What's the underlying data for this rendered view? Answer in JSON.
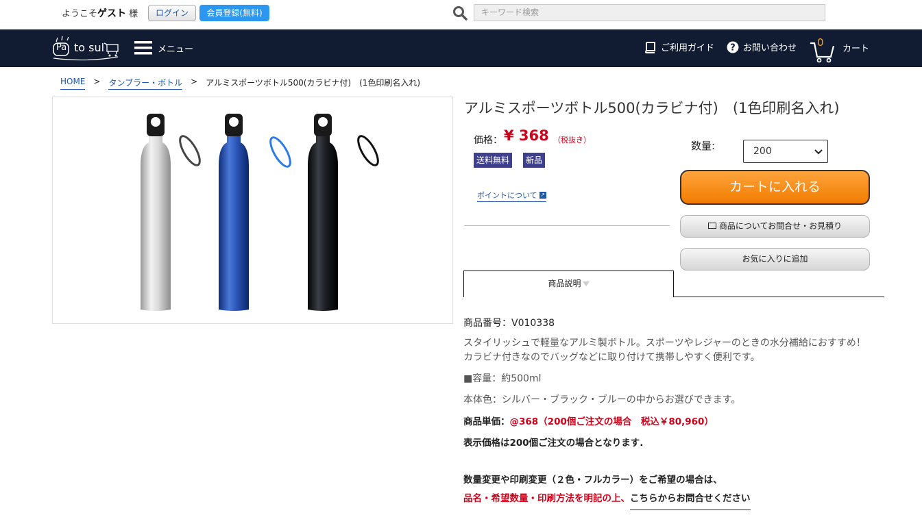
{
  "header": {
    "welcome_prefix": "ようこそ",
    "welcome_user": "ゲスト",
    "welcome_suffix": " 様",
    "login_label": "ログイン",
    "register_label": "会員登録(無料)",
    "search_placeholder": "キーワード検索"
  },
  "nav": {
    "logo_text": "to sul",
    "logo_badge": "Pa",
    "menu_label": "メニュー",
    "guide_label": "ご利用ガイド",
    "contact_label": "お問い合わせ",
    "cart_count": "0",
    "cart_label": "カート"
  },
  "breadcrumb": {
    "home": "HOME",
    "sep": ">",
    "category": "タンブラー・ボトル",
    "current": "アルミスポーツボトル500(カラビナ付)　(1色印刷名入れ)"
  },
  "product": {
    "title": "アルミスポーツボトル500(カラビナ付)　(1色印刷名入れ)",
    "price_label": "価格：",
    "price_value": "¥ 368",
    "price_tax_note": "（税抜き）",
    "badges": [
      "送料無料",
      "新品"
    ],
    "points_link": "ポイントについて",
    "qty_label": "数量:",
    "qty_value": "200",
    "cart_button": "カートに入れる",
    "inquiry_button": "商品についてお問合せ・お見積り",
    "favorite_button": "お気に入りに追加",
    "tab_label": "商品説明"
  },
  "description": {
    "code": "商品番号：V010338",
    "line1": "スタイリッシュで軽量なアルミ製ボトル。スポーツやレジャーのときの水分補給におすすめ！",
    "line2": "カラビナ付きなのでバッグなどに取り付けて携帯しやすく便利です。",
    "capacity": "■容量：約500ml",
    "colors": "本体色：シルバー・ブラック・ブルーの中からお選びできます。",
    "unit_price_label": "商品単価：",
    "unit_price_value": "@368（200個ご注文の場合　税込￥80,960）",
    "note": "表示価格は200個ご注文の場合となります.",
    "change_note": "数量変更や印刷変更（２色・フルカラー）をご希望の場合は、",
    "red_note": "品名・希望数量・印刷方法を明記の上、",
    "contact_link": "こちらからお問合せください"
  },
  "colors": {
    "nav_bg": "#111c33",
    "accent_orange": "#f07c00",
    "price_red": "#d0021b",
    "badge_bg": "#3f3f8f",
    "link_blue": "#1f56a5"
  }
}
